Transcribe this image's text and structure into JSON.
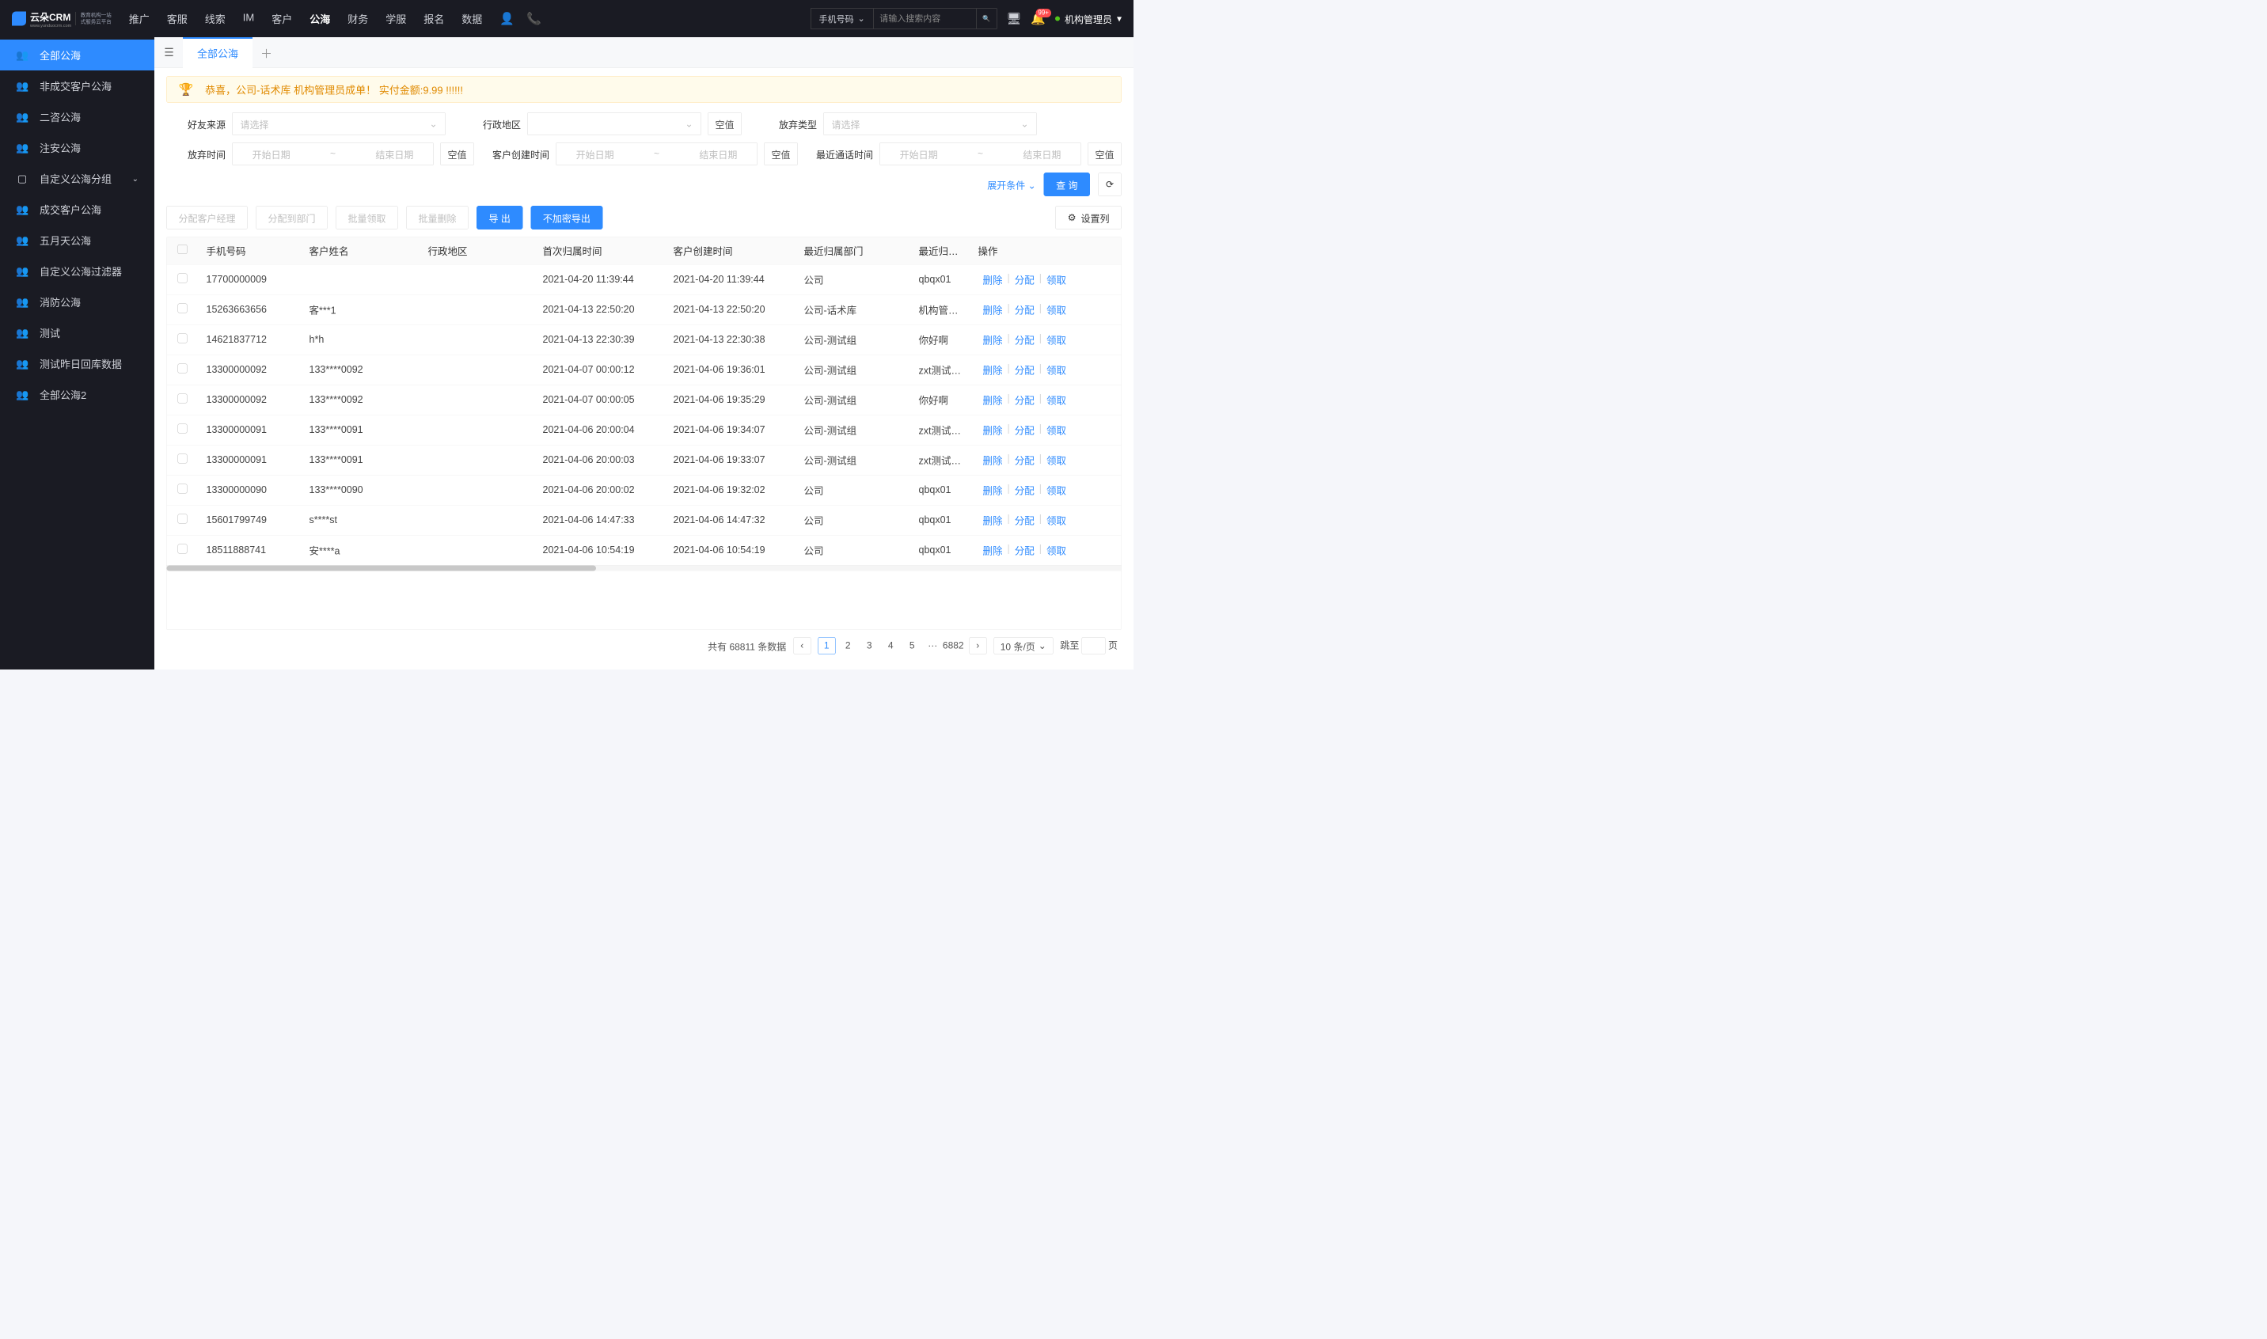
{
  "header": {
    "logo_main": "云朵CRM",
    "logo_sub1": "教育机构一站",
    "logo_sub2": "式服务云平台",
    "logo_url": "www.yunduocrm.com",
    "nav": [
      "推广",
      "客服",
      "线索",
      "IM",
      "客户",
      "公海",
      "财务",
      "学服",
      "报名",
      "数据"
    ],
    "nav_active_index": 5,
    "search_type": "手机号码",
    "search_placeholder": "请输入搜索内容",
    "badge": "99+",
    "user": "机构管理员"
  },
  "sidebar": {
    "items": [
      {
        "icon": "👥",
        "label": "全部公海",
        "active": true
      },
      {
        "icon": "👥",
        "label": "非成交客户公海"
      },
      {
        "icon": "👥",
        "label": "二咨公海"
      },
      {
        "icon": "👥",
        "label": "注安公海"
      },
      {
        "icon": "▢",
        "label": "自定义公海分组",
        "chevron": true
      },
      {
        "icon": "👥",
        "label": "成交客户公海"
      },
      {
        "icon": "👥",
        "label": "五月天公海"
      },
      {
        "icon": "👥",
        "label": "自定义公海过滤器"
      },
      {
        "icon": "👥",
        "label": "消防公海"
      },
      {
        "icon": "👥",
        "label": "测试"
      },
      {
        "icon": "👥",
        "label": "测试昨日回库数据"
      },
      {
        "icon": "👥",
        "label": "全部公海2"
      }
    ]
  },
  "tabs": {
    "active": "全部公海"
  },
  "banner": "恭喜，公司-话术库  机构管理员成单！  实付金额:9.99 !!!!!!",
  "filters": {
    "source_label": "好友来源",
    "source_ph": "请选择",
    "region_label": "行政地区",
    "empty_btn": "空值",
    "type_label": "放弃类型",
    "type_ph": "请选择",
    "abandon_label": "放弃时间",
    "create_label": "客户创建时间",
    "call_label": "最近通话时间",
    "date_start": "开始日期",
    "date_end": "结束日期",
    "expand": "展开条件",
    "query": "查 询"
  },
  "actions": {
    "assign_mgr": "分配客户经理",
    "assign_dept": "分配到部门",
    "batch_take": "批量领取",
    "batch_del": "批量删除",
    "export": "导 出",
    "export_plain": "不加密导出",
    "settings": "设置列"
  },
  "table": {
    "headers": [
      "手机号码",
      "客户姓名",
      "行政地区",
      "首次归属时间",
      "客户创建时间",
      "最近归属部门",
      "最近归属人",
      "操作"
    ],
    "ops": [
      "删除",
      "分配",
      "领取"
    ],
    "rows": [
      {
        "phone": "17700000009",
        "name": "",
        "region": "",
        "first": "2021-04-20 11:39:44",
        "create": "2021-04-20 11:39:44",
        "dept": "公司",
        "owner": "qbqx01"
      },
      {
        "phone": "15263663656",
        "name": "客***1",
        "region": "",
        "first": "2021-04-13 22:50:20",
        "create": "2021-04-13 22:50:20",
        "dept": "公司-话术库",
        "owner": "机构管理员"
      },
      {
        "phone": "14621837712",
        "name": "h*h",
        "region": "",
        "first": "2021-04-13 22:30:39",
        "create": "2021-04-13 22:30:38",
        "dept": "公司-测试组",
        "owner": "你好啊"
      },
      {
        "phone": "13300000092",
        "name": "133****0092",
        "region": "",
        "first": "2021-04-07 00:00:12",
        "create": "2021-04-06 19:36:01",
        "dept": "公司-测试组",
        "owner": "zxt测试导入"
      },
      {
        "phone": "13300000092",
        "name": "133****0092",
        "region": "",
        "first": "2021-04-07 00:00:05",
        "create": "2021-04-06 19:35:29",
        "dept": "公司-测试组",
        "owner": "你好啊"
      },
      {
        "phone": "13300000091",
        "name": "133****0091",
        "region": "",
        "first": "2021-04-06 20:00:04",
        "create": "2021-04-06 19:34:07",
        "dept": "公司-测试组",
        "owner": "zxt测试导入"
      },
      {
        "phone": "13300000091",
        "name": "133****0091",
        "region": "",
        "first": "2021-04-06 20:00:03",
        "create": "2021-04-06 19:33:07",
        "dept": "公司-测试组",
        "owner": "zxt测试导入"
      },
      {
        "phone": "13300000090",
        "name": "133****0090",
        "region": "",
        "first": "2021-04-06 20:00:02",
        "create": "2021-04-06 19:32:02",
        "dept": "公司",
        "owner": "qbqx01"
      },
      {
        "phone": "15601799749",
        "name": "s****st",
        "region": "",
        "first": "2021-04-06 14:47:33",
        "create": "2021-04-06 14:47:32",
        "dept": "公司",
        "owner": "qbqx01"
      },
      {
        "phone": "18511888741",
        "name": "安****a",
        "region": "",
        "first": "2021-04-06 10:54:19",
        "create": "2021-04-06 10:54:19",
        "dept": "公司",
        "owner": "qbqx01"
      }
    ]
  },
  "pager": {
    "total_label": "共有 68811 条数据",
    "pages": [
      "1",
      "2",
      "3",
      "4",
      "5"
    ],
    "ellipsis": "···",
    "last": "6882",
    "size": "10 条/页",
    "jump_label": "跳至",
    "jump_unit": "页"
  }
}
